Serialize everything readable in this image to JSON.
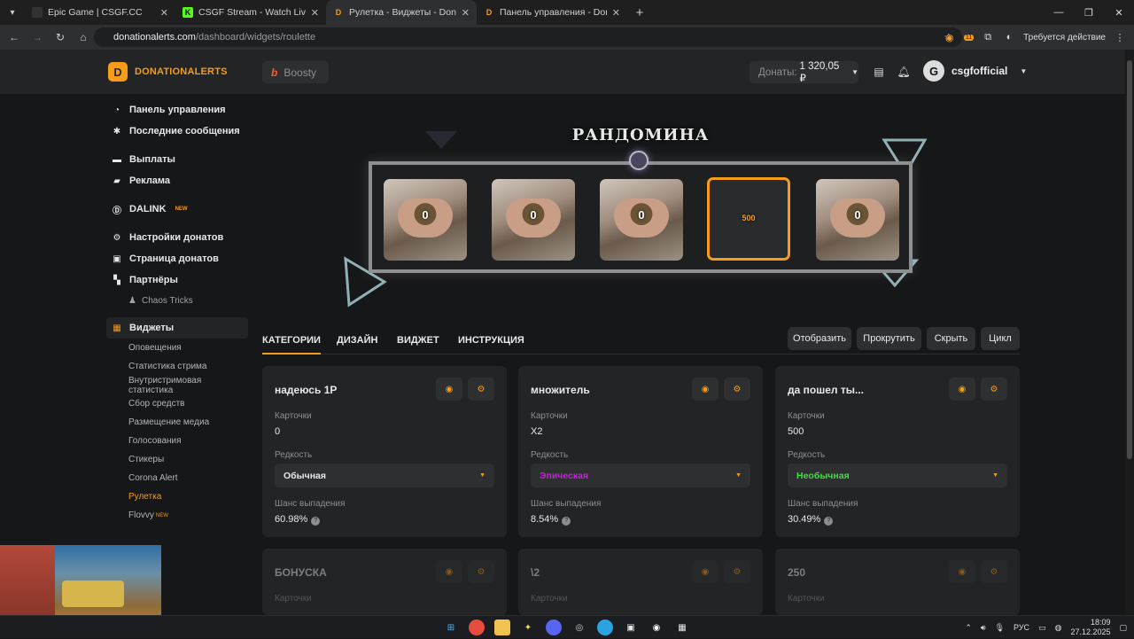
{
  "browser": {
    "tabs": [
      {
        "title": "Epic Game | CSGF.CC",
        "close": "✕"
      },
      {
        "title": "CSGF Stream - Watch Live on K",
        "close": "✕"
      },
      {
        "title": "Рулетка - Виджеты - Donationa",
        "close": "✕"
      },
      {
        "title": "Панель управления - Donatior",
        "close": "✕"
      }
    ],
    "url_domain": "donationalerts.com",
    "url_path": "/dashboard/widgets/roulette",
    "profile_action": "Требуется действие",
    "extension_badge": "11"
  },
  "header": {
    "brand": "DONATIONALERTS",
    "boosty_label": "Boosty",
    "donations_label": "Донаты:",
    "donations_value": "1 320,05 ₽",
    "username": "csgfofficial"
  },
  "sidebar": {
    "main": [
      {
        "label": "Панель управления",
        "icon": "dashboard-icon"
      },
      {
        "label": "Последние сообщения",
        "icon": "messages-icon"
      }
    ],
    "finance": [
      {
        "label": "Выплаты",
        "icon": "payouts-icon"
      },
      {
        "label": "Реклама",
        "icon": "ads-icon"
      }
    ],
    "dalink": {
      "label": "DALINK",
      "badge": "NEW"
    },
    "settings": [
      {
        "label": "Настройки донатов",
        "icon": "gear-icon"
      },
      {
        "label": "Страница донатов",
        "icon": "page-icon"
      },
      {
        "label": "Партнёры",
        "icon": "partners-icon"
      }
    ],
    "partner_item": "Chaos Tricks",
    "widgets_label": "Виджеты",
    "widget_items": [
      "Оповещения",
      "Статистика стрима",
      "Внутристримовая статистика",
      "Сбор средств",
      "Размещение медиа",
      "Голосования",
      "Стикеры",
      "Corona Alert",
      "Рулетка"
    ],
    "flovvy": {
      "label": "Flovvy",
      "badge": "NEW"
    }
  },
  "preview": {
    "title": "РАНДОМИНА",
    "cards": [
      "0",
      "0",
      "0",
      "500",
      "0"
    ],
    "selected_index": 3
  },
  "tabs": [
    "КАТЕГОРИИ",
    "ДИЗАЙН",
    "ВИДЖЕТ",
    "ИНСТРУКЦИЯ"
  ],
  "actions": [
    "Отобразить",
    "Прокрутить",
    "Скрыть",
    "Цикл"
  ],
  "labels": {
    "cards": "Карточки",
    "rarity": "Редкость",
    "chance": "Шанс выпадения"
  },
  "categories": [
    {
      "name": "надеюсь 1Р",
      "cards": "0",
      "rarity": "Обычная",
      "rarity_color": "#e8e8e8",
      "chance": "60.98%"
    },
    {
      "name": "множитель",
      "cards": "X2",
      "rarity": "Эпическая",
      "rarity_color": "#c026d3",
      "chance": "8.54%"
    },
    {
      "name": "да пошел ты...",
      "cards": "500",
      "rarity": "Необычная",
      "rarity_color": "#3be33b",
      "chance": "30.49%"
    },
    {
      "name": "БОНУСКА"
    },
    {
      "name": "\\2"
    },
    {
      "name": "250"
    }
  ],
  "taskbar": {
    "lang": "РУС",
    "time": "18:09",
    "date": "27.12.2025"
  },
  "colors": {
    "accent": "#f59c1a",
    "bg": "#161718",
    "panel": "#232425"
  }
}
